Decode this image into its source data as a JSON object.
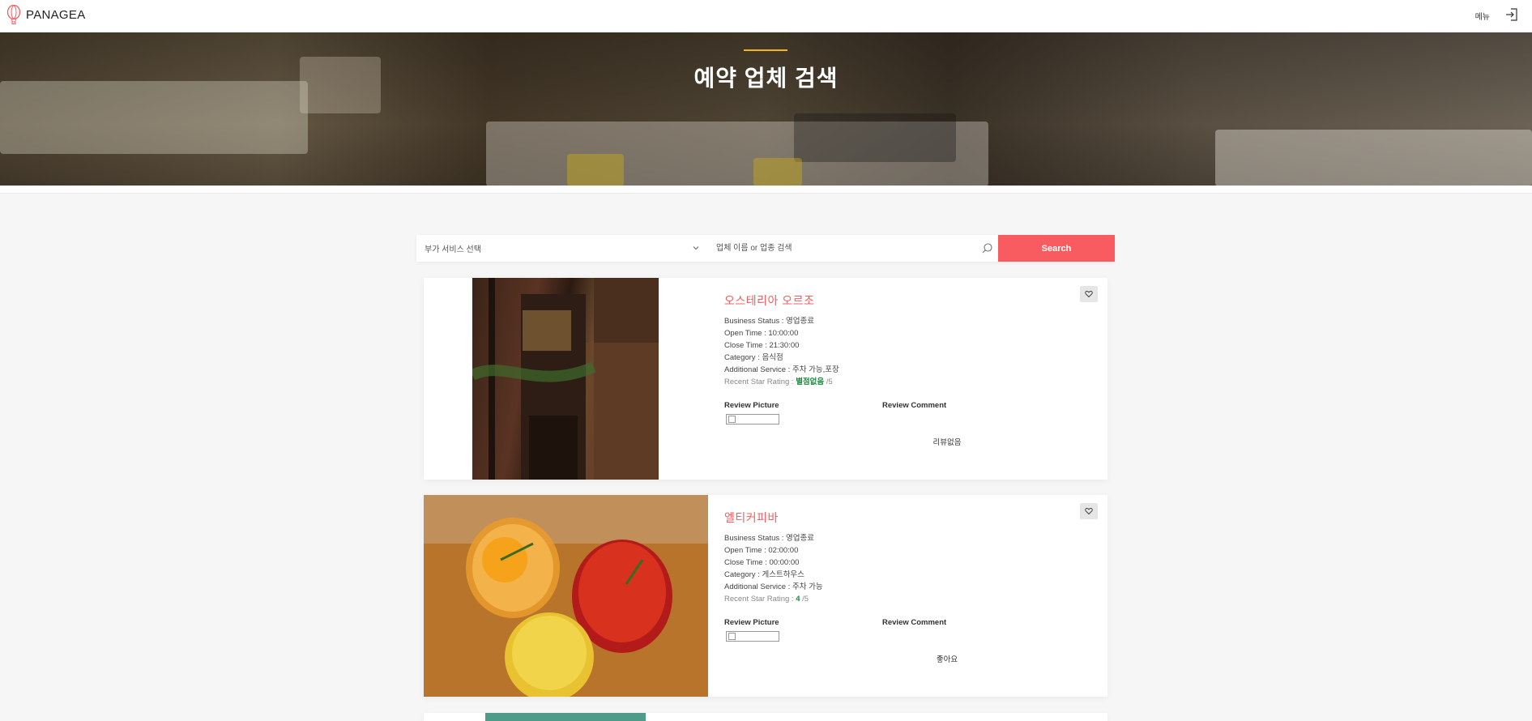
{
  "header": {
    "logo_text": "PANAGEA",
    "menu_label": "메뉴"
  },
  "hero": {
    "title": "예약 업체 검색"
  },
  "search": {
    "select_value": "부가 서비스 선택",
    "input_placeholder": "업체 이름 or 업종 검색",
    "button_label": "Search"
  },
  "labels": {
    "business_status": "Business Status : ",
    "open_time": "Open Time : ",
    "close_time": "Close Time : ",
    "category": "Category : ",
    "additional_service": "Additional Service : ",
    "recent_star_rating": "Recent Star Rating : ",
    "rating_suffix": " /5",
    "review_picture": "Review Picture",
    "review_comment": "Review Comment"
  },
  "businesses": [
    {
      "name": "오스테리아 오르조",
      "status": "영업종료",
      "open_time": "10:00:00",
      "close_time": "21:30:00",
      "category": "음식점",
      "additional_service": "주차 가능,포장",
      "rating": "별점없음",
      "review_comment": "리뷰없음"
    },
    {
      "name": "엘티커피바",
      "status": "영업종료",
      "open_time": "02:00:00",
      "close_time": "00:00:00",
      "category": "게스트하우스",
      "additional_service": "주차 가능",
      "rating": "4",
      "review_comment": "좋아요"
    }
  ],
  "colors": {
    "accent": "#f85c60",
    "rating_green": "#1a8a3e",
    "hero_line": "#f3b71b"
  }
}
